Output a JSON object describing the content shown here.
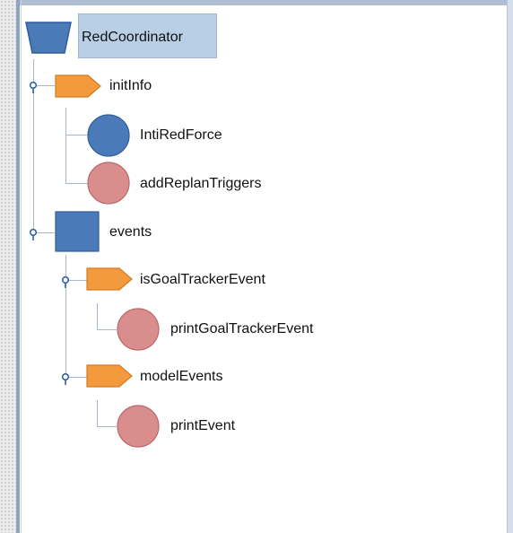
{
  "tree": {
    "root": {
      "label": "RedCoordinator",
      "icon": "trapezoid-icon"
    },
    "children": [
      {
        "label": "initInfo",
        "icon": "tag-icon",
        "children": [
          {
            "label": "IntiRedForce",
            "icon": "blue-circle-icon"
          },
          {
            "label": "addReplanTriggers",
            "icon": "pink-circle-icon"
          }
        ]
      },
      {
        "label": "events",
        "icon": "blue-square-icon",
        "children": [
          {
            "label": "isGoalTrackerEvent",
            "icon": "tag-icon",
            "children": [
              {
                "label": "printGoalTrackerEvent",
                "icon": "pink-circle-icon"
              }
            ]
          },
          {
            "label": "modelEvents",
            "icon": "tag-icon",
            "children": [
              {
                "label": "printEvent",
                "icon": "pink-circle-icon"
              }
            ]
          }
        ]
      }
    ]
  },
  "colors": {
    "blue": "#4a7ab8",
    "orange": "#f39a3e",
    "pink": "#d98d8d",
    "selection": "#b9cfe6"
  }
}
